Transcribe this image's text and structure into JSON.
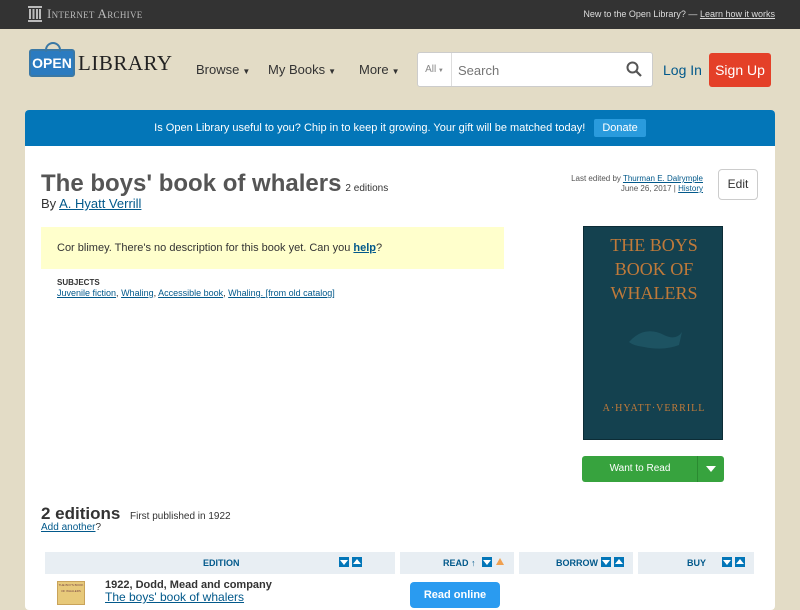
{
  "topbar": {
    "logo_text": "Internet Archive",
    "prompt_text": "New to the Open Library? —",
    "prompt_link": "Learn how it works"
  },
  "header": {
    "logo_sign": "OPEN",
    "logo_word": "LIBRARY",
    "nav": {
      "browse": "Browse",
      "my_books": "My Books",
      "more": "More"
    },
    "search": {
      "scope": "All",
      "placeholder": "Search"
    },
    "login": "Log In",
    "signup": "Sign Up"
  },
  "banner": {
    "text": "Is Open Library useful to you? Chip in to keep it growing. Your gift will be matched today!",
    "donate": "Donate"
  },
  "book": {
    "title": "The boys' book of whalers",
    "editions_count": "2 editions",
    "by_label": "By",
    "author": "A. Hyatt Verrill",
    "last_edited_label": "Last edited by",
    "last_edited_by": "Thurman E. Dalrymple",
    "last_edited_date": "June 26, 2017",
    "history_link": "History",
    "edit_button": "Edit",
    "no_description_text": "Cor blimey. There's no description for this book yet. Can you",
    "no_description_link": "help",
    "no_description_end": "?",
    "subjects_label": "SUBJECTS",
    "subjects": [
      "Juvenile fiction",
      "Whaling",
      "Accessible book",
      "Whaling. [from old catalog]"
    ],
    "cover_title": "THE BOYS BOOK OF WHALERS",
    "cover_author": "A·HYATT·VERRILL",
    "want_to_read": "Want to Read"
  },
  "editions": {
    "heading": "2 editions",
    "first_published": "First published in 1922",
    "add_another_link": "Add another",
    "add_another_suffix": "?",
    "columns": {
      "edition": "EDITION",
      "read": "READ ↑",
      "borrow": "BORROW",
      "buy": "BUY"
    },
    "rows": [
      {
        "thumb_text": "THE BOYS BOOK OF WHALERS",
        "publisher": "1922, Dodd, Mead and company",
        "title": "The boys' book of whalers",
        "read_button": "Read online"
      }
    ]
  },
  "colors": {
    "banner": "#0376b8",
    "signup": "#e44028",
    "want_to_read": "#37a33e",
    "read_online": "#2a9bf0",
    "description_bg": "#ffffcc"
  }
}
